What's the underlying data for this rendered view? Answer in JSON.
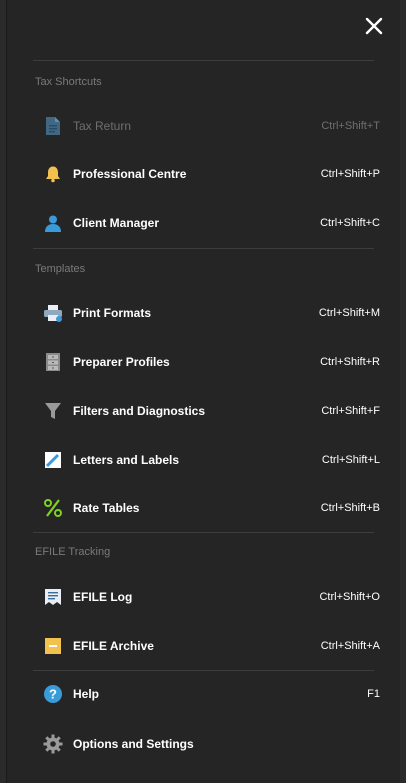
{
  "sections": {
    "tax_shortcuts": {
      "label": "Tax Shortcuts",
      "items": [
        {
          "label": "Tax Return",
          "shortcut": "Ctrl+Shift+T",
          "icon": "document-icon",
          "enabled": false
        },
        {
          "label": "Professional Centre",
          "shortcut": "Ctrl+Shift+P",
          "icon": "bell-icon",
          "enabled": true
        },
        {
          "label": "Client Manager",
          "shortcut": "Ctrl+Shift+C",
          "icon": "person-icon",
          "enabled": true
        }
      ]
    },
    "templates": {
      "label": "Templates",
      "items": [
        {
          "label": "Print Formats",
          "shortcut": "Ctrl+Shift+M",
          "icon": "printer-icon"
        },
        {
          "label": "Preparer Profiles",
          "shortcut": "Ctrl+Shift+R",
          "icon": "cabinet-icon"
        },
        {
          "label": "Filters and Diagnostics",
          "shortcut": "Ctrl+Shift+F",
          "icon": "filter-icon"
        },
        {
          "label": "Letters and Labels",
          "shortcut": "Ctrl+Shift+L",
          "icon": "pen-icon"
        },
        {
          "label": "Rate Tables",
          "shortcut": "Ctrl+Shift+B",
          "icon": "percent-icon"
        }
      ]
    },
    "efile_tracking": {
      "label": "EFILE Tracking",
      "items": [
        {
          "label": "EFILE Log",
          "shortcut": "Ctrl+Shift+O",
          "icon": "book-icon"
        },
        {
          "label": "EFILE Archive",
          "shortcut": "Ctrl+Shift+A",
          "icon": "archive-icon"
        }
      ]
    },
    "bottom": {
      "items": [
        {
          "label": "Help",
          "shortcut": "F1",
          "icon": "help-icon"
        },
        {
          "label": "Options and Settings",
          "shortcut": "",
          "icon": "gear-icon"
        }
      ]
    }
  },
  "colors": {
    "background": "#252525",
    "text": "#ffffff",
    "muted": "#7a7a7a",
    "accent_blue": "#3a9bd9",
    "accent_yellow": "#f2c14e",
    "accent_green": "#7ed321"
  }
}
